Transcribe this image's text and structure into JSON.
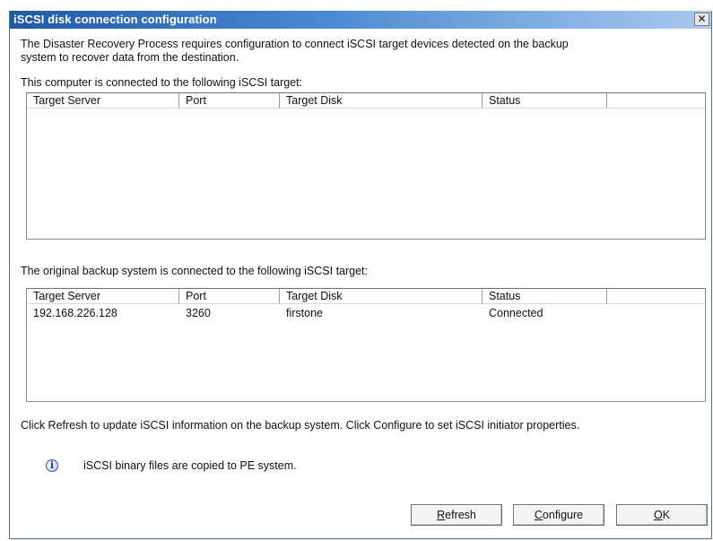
{
  "window": {
    "title": "iSCSI disk connection configuration",
    "close_glyph": "✕"
  },
  "intro": {
    "line1": "The Disaster Recovery Process requires configuration to connect iSCSI target devices detected on the backup",
    "line2": "system to recover data from the destination."
  },
  "current": {
    "label": "This computer is connected to the following iSCSI target:",
    "columns": [
      "Target Server",
      "Port",
      "Target Disk",
      "Status"
    ],
    "rows": []
  },
  "original": {
    "label": "The original backup system is connected to the following iSCSI target:",
    "columns": [
      "Target Server",
      "Port",
      "Target Disk",
      "Status"
    ],
    "rows": [
      {
        "server": "192.168.226.128",
        "port": "3260",
        "disk": "firstone",
        "status": "Connected"
      }
    ]
  },
  "help_text": "Click Refresh to update iSCSI information on the backup system. Click Configure to set iSCSI initiator properties.",
  "info": {
    "icon": "info-icon",
    "text": "iSCSI binary files are copied to PE system."
  },
  "buttons": {
    "refresh": {
      "accel": "R",
      "rest": "efresh"
    },
    "configure": {
      "accel": "C",
      "rest": "onfigure"
    },
    "ok": {
      "accel": "O",
      "rest": "K"
    }
  }
}
